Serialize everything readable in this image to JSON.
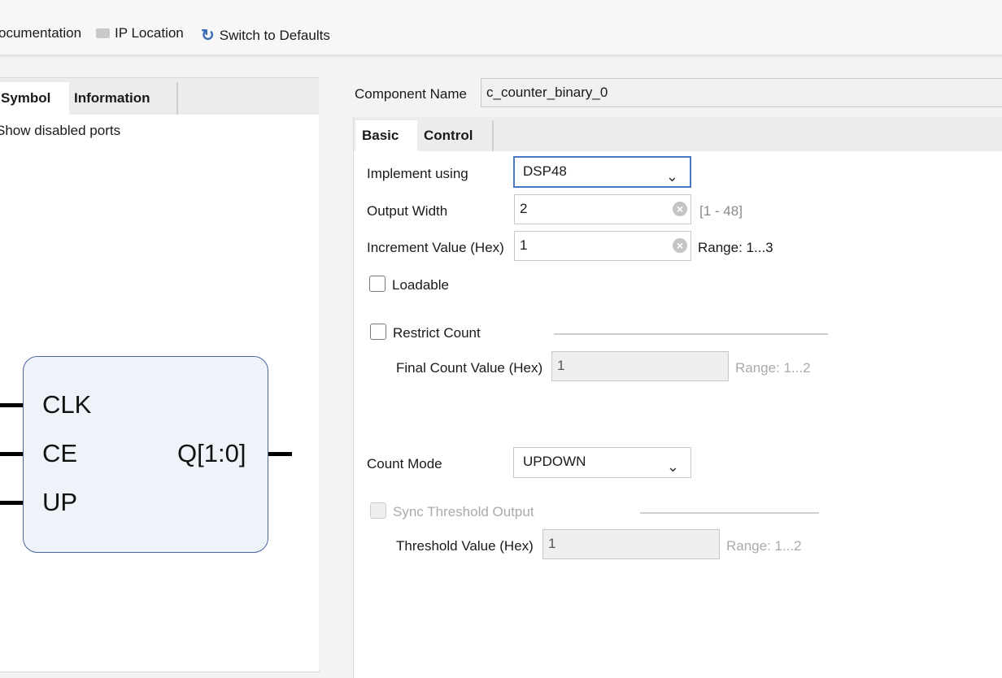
{
  "toolbar": {
    "documentation": "ocumentation",
    "ip_location": "IP Location",
    "switch_defaults": "Switch to Defaults"
  },
  "left_panel": {
    "tabs": [
      "Symbol",
      "Information"
    ],
    "show_disabled_ports": "Show disabled ports",
    "symbol": {
      "inputs": [
        "CLK",
        "CE",
        "UP"
      ],
      "output": "Q[1:0]"
    }
  },
  "right_panel": {
    "component_name_label": "Component Name",
    "component_name": "c_counter_binary_0",
    "tabs": [
      "Basic",
      "Control"
    ],
    "implement_using": {
      "label": "Implement using",
      "value": "DSP48"
    },
    "output_width": {
      "label": "Output Width",
      "value": "2",
      "range": "[1 - 48]"
    },
    "increment_value": {
      "label": "Increment Value (Hex)",
      "value": "1",
      "range": "Range: 1...3"
    },
    "loadable": {
      "label": "Loadable",
      "checked": false
    },
    "restrict_count": {
      "label": "Restrict Count",
      "checked": false
    },
    "final_count": {
      "label": "Final Count Value (Hex)",
      "value": "1",
      "range": "Range: 1...2"
    },
    "count_mode": {
      "label": "Count Mode",
      "value": "UPDOWN"
    },
    "sync_threshold": {
      "label": "Sync Threshold Output",
      "checked": false,
      "disabled": true
    },
    "threshold_value": {
      "label": "Threshold Value (Hex)",
      "value": "1",
      "range": "Range: 1...2"
    }
  },
  "colors": {
    "accent_focus": "#4a78c8",
    "symbol_fill": "#eef3fa",
    "symbol_border": "#4a64a0"
  }
}
